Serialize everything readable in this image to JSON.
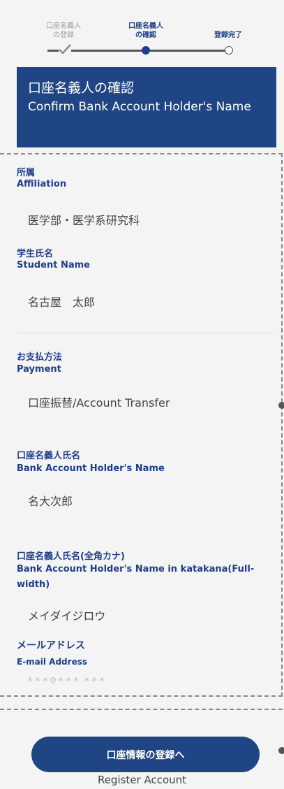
{
  "stepper": {
    "steps": [
      {
        "label": "口座名義人\nの登録",
        "state": "done"
      },
      {
        "label": "口座名義人\nの確認",
        "state": "current"
      },
      {
        "label": "登録完了",
        "state": "todo"
      }
    ]
  },
  "banner": {
    "title_ja": "口座名義人の確認",
    "title_en": "Confirm Bank Account Holder's Name"
  },
  "fields": {
    "affiliation": {
      "label_ja": "所属",
      "label_en": "Affiliation",
      "value": "医学部・医学系研究科"
    },
    "student_name": {
      "label_ja": "学生氏名",
      "label_en": "Student Name",
      "value": "名古屋　太郎"
    },
    "payment": {
      "label_ja": "お支払方法",
      "label_en": "Payment",
      "value": "口座振替/Account Transfer"
    },
    "holder_name": {
      "label_ja": "口座名義人氏名",
      "label_en": "Bank Account Holder's Name",
      "value": "名大次郎"
    },
    "holder_kana": {
      "label_ja": "口座名義人氏名(全角カナ)",
      "label_en": "Bank Account Holder's Name in katakana(Full-width)",
      "value": "メイダイジロウ"
    },
    "email": {
      "label_ja": "メールアドレス",
      "label_en": "E-mail Address",
      "value": "＊＊＊@＊＊＊.＊＊＊"
    }
  },
  "actions": {
    "register_label": "口座情報の登録へ",
    "register_sub": "Register Account"
  },
  "colors": {
    "accent": "#1f4585",
    "label": "#1f3f86"
  }
}
